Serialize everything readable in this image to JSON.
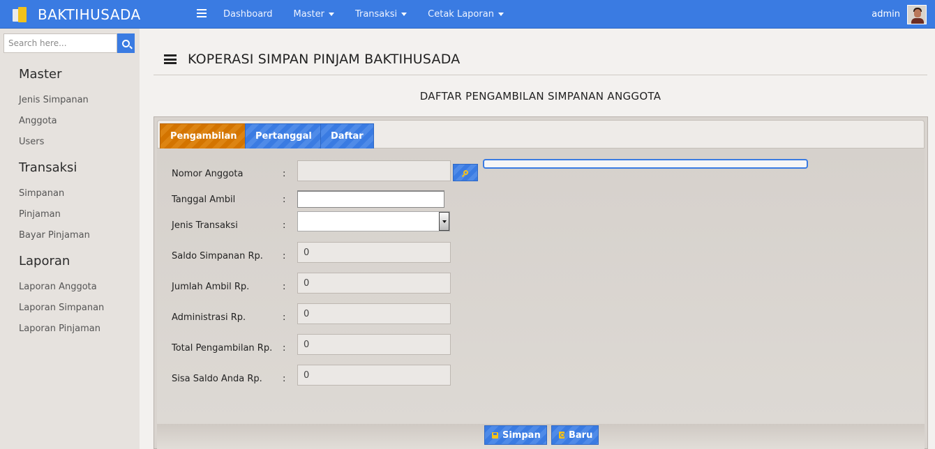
{
  "navbar": {
    "brand": "BAKTIHUSADA",
    "menu": [
      {
        "label": "Dashboard",
        "dropdown": false
      },
      {
        "label": "Master",
        "dropdown": true
      },
      {
        "label": "Transaksi",
        "dropdown": true
      },
      {
        "label": "Cetak Laporan",
        "dropdown": true
      }
    ],
    "user": "admin",
    "color": "#3a7be2"
  },
  "sidebar": {
    "search_placeholder": "Search here...",
    "sections": [
      {
        "title": "Master",
        "items": [
          "Jenis Simpanan",
          "Anggota",
          "Users"
        ]
      },
      {
        "title": "Transaksi",
        "items": [
          "Simpanan",
          "Pinjaman",
          "Bayar Pinjaman"
        ]
      },
      {
        "title": "Laporan",
        "items": [
          "Laporan Anggota",
          "Laporan Simpanan",
          "Laporan Pinjaman"
        ]
      }
    ]
  },
  "page": {
    "title": "KOPERASI SIMPAN PINJAM BAKTIHUSADA",
    "subtitle": "DAFTAR PENGAMBILAN SIMPANAN ANGGOTA"
  },
  "tabs": [
    {
      "label": "Pengambilan",
      "active": true
    },
    {
      "label": "Pertanggal",
      "active": false
    },
    {
      "label": "Daftar",
      "active": false
    }
  ],
  "form": {
    "colon": ":",
    "nomor_anggota": {
      "label": "Nomor Anggota",
      "value": ""
    },
    "tanggal_ambil": {
      "label": "Tanggal Ambil",
      "value": ""
    },
    "jenis_transaksi": {
      "label": "Jenis Transaksi",
      "value": ""
    },
    "saldo_simpanan": {
      "label": "Saldo Simpanan Rp.",
      "value": "0"
    },
    "jumlah_ambil": {
      "label": "Jumlah Ambil Rp.",
      "value": "0"
    },
    "administrasi": {
      "label": "Administrasi Rp.",
      "value": "0"
    },
    "total_pengambilan": {
      "label": "Total Pengambilan Rp.",
      "value": "0"
    },
    "sisa_saldo": {
      "label": "Sisa Saldo Anda Rp.",
      "value": "0"
    }
  },
  "actions": {
    "save_label": "Simpan",
    "new_label": "Baru"
  },
  "colors": {
    "accent": "#3a7be2",
    "active_tab": "#d37400",
    "icon_yellow": "#f5c21a"
  }
}
